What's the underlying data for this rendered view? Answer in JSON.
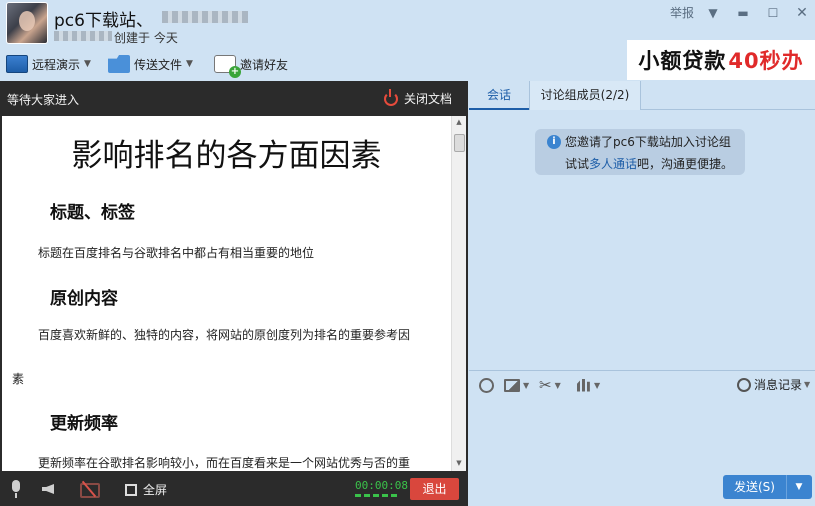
{
  "titlebar": {
    "chat_title": "pc6下载站、",
    "created_text": "创建于 今天",
    "report_label": "举报",
    "icons": {
      "dropdown": "chevron-down-icon",
      "minimize": "minimize-icon",
      "maximize": "maximize-icon",
      "close": "close-icon"
    }
  },
  "toolbar": {
    "remote_demo": "远程演示",
    "send_file": "传送文件",
    "invite_friends": "邀请好友"
  },
  "ad": {
    "text": "小额贷款",
    "highlight": "40秒办"
  },
  "document": {
    "waiting_text": "等待大家进入",
    "close_doc_label": "关闭文档",
    "title": "影响排名的各方面因素",
    "sections": [
      {
        "heading": "标题、标签",
        "body": "标题在百度排名与谷歌排名中都占有相当重要的地位"
      },
      {
        "heading": "原创内容",
        "body": "百度喜欢新鲜的、独特的内容，将网站的原创度列为排名的重要参考因",
        "body_cont": "素"
      },
      {
        "heading": "更新频率",
        "body": "更新频率在谷歌排名影响较小，而在百度看来是一个网站优秀与否的重"
      }
    ]
  },
  "doc_footer": {
    "fullscreen_label": "全屏",
    "timer": "00:00:08",
    "exit_label": "退出"
  },
  "right": {
    "tabs": [
      {
        "label": "会话"
      },
      {
        "label": "讨论组成员(2/2)"
      }
    ],
    "notice": {
      "line1": "您邀请了pc6下载站加入讨论组",
      "line2_prefix": "试试",
      "line2_link": "多人通话",
      "line2_suffix": "吧，沟通更便捷。"
    },
    "history_label": "消息记录",
    "send_label": "发送(S)"
  },
  "colors": {
    "accent": "#3b84d0",
    "exit_red": "#d9473d",
    "panel_bg": "#cfe2f3",
    "doc_dark": "#2b2b2b"
  }
}
